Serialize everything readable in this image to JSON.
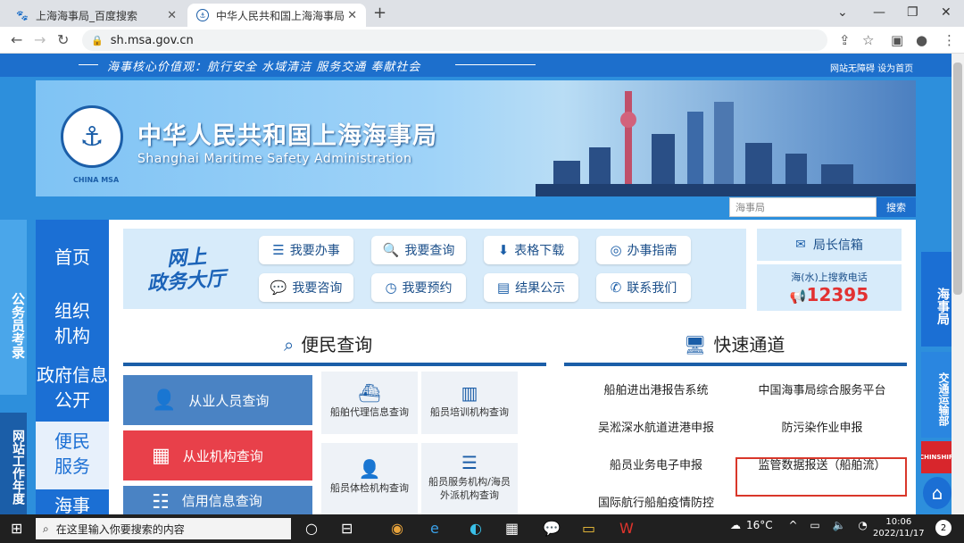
{
  "browser": {
    "tabs": [
      {
        "label": "上海海事局_百度搜索"
      },
      {
        "label": "中华人民共和国上海海事局"
      }
    ],
    "url": "sh.msa.gov.cn"
  },
  "page": {
    "slogan": "海事核心价值观：航行安全 水域清洁 服务交通 奉献社会",
    "top_links": "网站无障碍 设为首页",
    "site_title_cn": "中华人民共和国上海海事局",
    "site_title_en": "Shanghai Maritime Safety Administration",
    "logo_text": "CHINA MSA",
    "search": {
      "placeholder": "海事局",
      "button": "搜索"
    },
    "left_nav": [
      "首页",
      "组织机构",
      "政府信息公开",
      "便民服务",
      "海事"
    ],
    "left_float": [
      "公务员考录",
      "网站工作年度"
    ],
    "hall": {
      "title_line1": "网上",
      "title_line2": "政务大厅",
      "buttons": [
        "我要办事",
        "我要查询",
        "表格下载",
        "办事指南",
        "我要咨询",
        "我要预约",
        "结果公示",
        "联系我们"
      ]
    },
    "mailbox": "局长信箱",
    "hotline": {
      "label": "海(水)上搜救电话",
      "number": "12395"
    },
    "convenience": {
      "title": "便民查询",
      "big_buttons": [
        "从业人员查询",
        "从业机构查询",
        "信用信息查询"
      ],
      "small_tiles": [
        "船舶代理信息查询",
        "船员培训机构查询",
        "船员体检机构查询",
        "船员服务机构/海员外派机构查询"
      ]
    },
    "fast": {
      "title": "快速通道",
      "links": [
        "船舶进出港报告系统",
        "中国海事局综合服务平台",
        "吴淞深水航道进港申报",
        "防污染作业申报",
        "船员业务电子申报",
        "监管数据报送（船舶流）",
        "国际航行船舶疫情防控"
      ]
    },
    "right_strip": [
      "海事局",
      "交通运输部",
      "CHINSHIP"
    ]
  },
  "taskbar": {
    "search_placeholder": "在这里输入你要搜索的内容",
    "weather": "16°C",
    "time": "10:06",
    "date": "2022/11/17",
    "notification_count": "2"
  },
  "colors": {
    "nav_blue": "#1b6fd4",
    "alert_red": "#e23131",
    "highlight_red": "#d9372a"
  }
}
